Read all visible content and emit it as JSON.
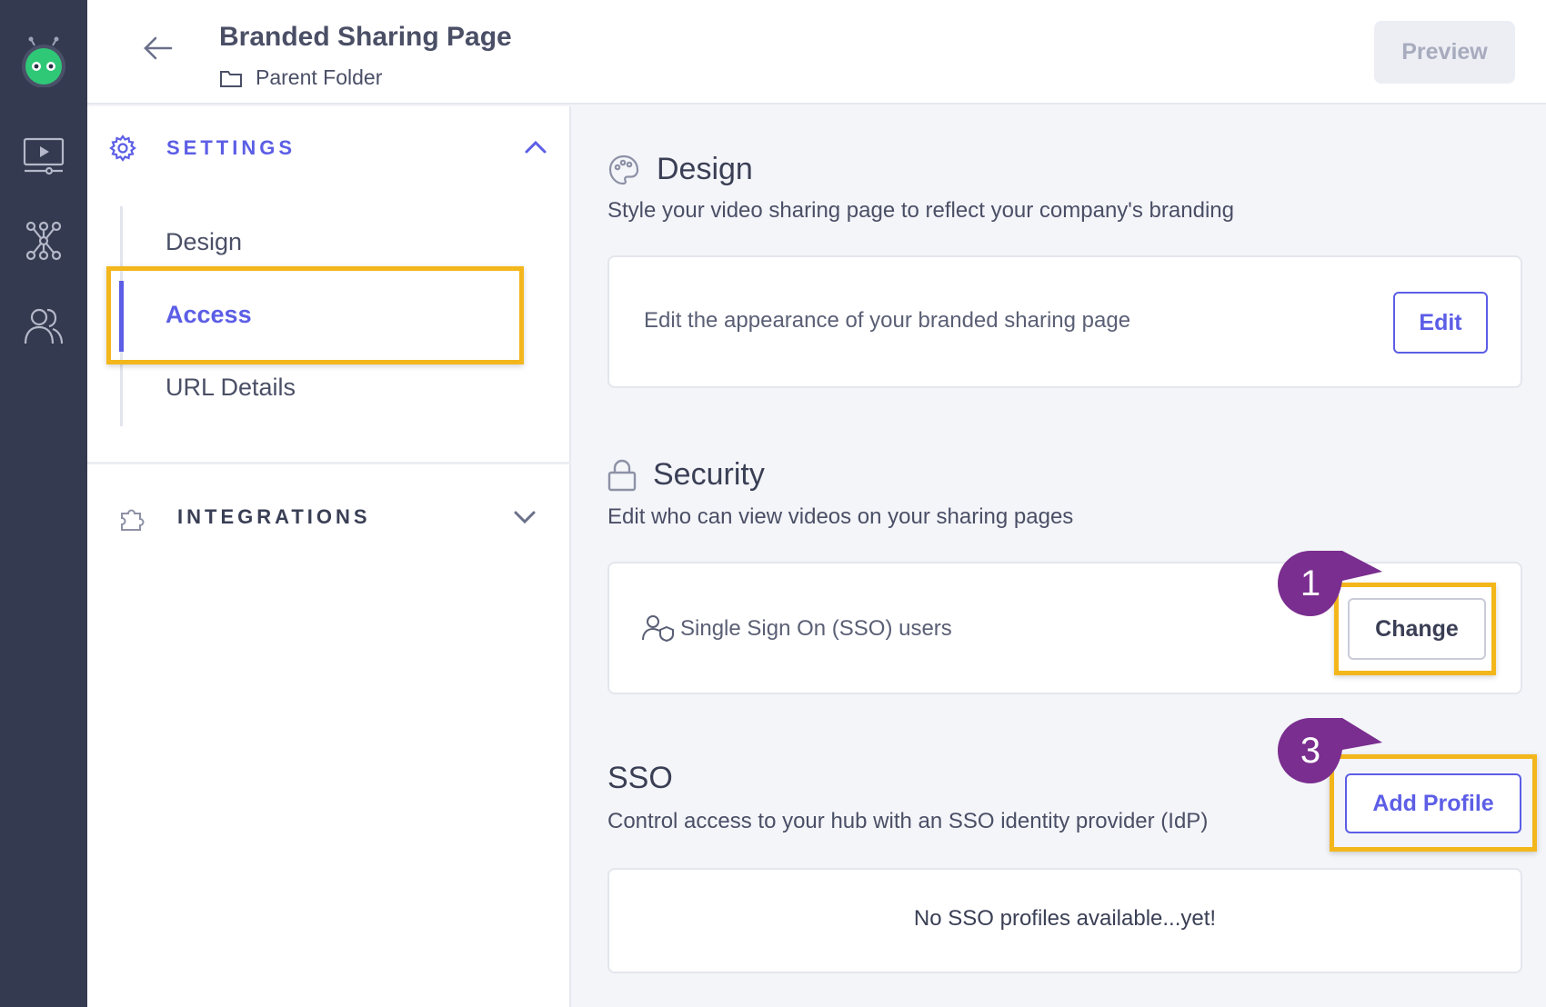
{
  "rail": {
    "icons": [
      "robot-logo-icon",
      "video-library-icon",
      "network-hub-icon",
      "users-icon"
    ]
  },
  "header": {
    "title": "Branded Sharing Page",
    "folder": "Parent Folder",
    "preview_label": "Preview"
  },
  "sidebar": {
    "settings_label": "SETTINGS",
    "items": [
      {
        "label": "Design"
      },
      {
        "label": "Access"
      },
      {
        "label": "URL Details"
      }
    ],
    "integrations_label": "INTEGRATIONS"
  },
  "main": {
    "design": {
      "heading": "Design",
      "description": "Style your video sharing page to reflect your company's branding",
      "card_text": "Edit the appearance of your branded sharing page",
      "edit_label": "Edit"
    },
    "security": {
      "heading": "Security",
      "description": "Edit who can view videos on your sharing pages",
      "card_text": "Single Sign On (SSO) users",
      "change_label": "Change"
    },
    "sso": {
      "heading": "SSO",
      "description": "Control access to your hub with an SSO identity provider (IdP)",
      "add_label": "Add Profile",
      "empty_text": "No SSO profiles available...yet!"
    }
  },
  "annotations": {
    "step_one": "1",
    "step_three": "3"
  },
  "colors": {
    "accent": "#5c5ee6",
    "highlight": "#f3b61b",
    "marker": "#7a2e8f",
    "rail": "#343a50"
  }
}
